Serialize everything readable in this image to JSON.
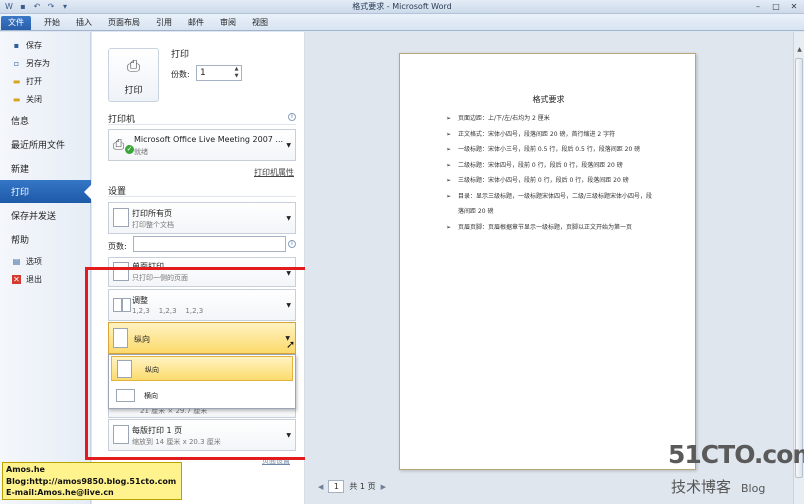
{
  "window": {
    "title": "格式要求 - Microsoft Word",
    "qat_icons": [
      "word-logo-icon",
      "save-icon",
      "undo-icon",
      "redo-icon",
      "customize-icon"
    ],
    "controls": [
      "minimize-icon",
      "maximize-icon",
      "close-icon"
    ]
  },
  "ribbon": {
    "tabs": [
      "文件",
      "开始",
      "插入",
      "页面布局",
      "引用",
      "邮件",
      "审阅",
      "视图"
    ]
  },
  "nav": {
    "save": "保存",
    "save_as": "另存为",
    "open": "打开",
    "close": "关闭",
    "info": "信息",
    "recent": "最近所用文件",
    "new": "新建",
    "print": "打印",
    "save_send": "保存并发送",
    "help": "帮助",
    "options": "选项",
    "exit": "退出"
  },
  "print": {
    "button_label": "打印",
    "heading": "打印",
    "copies_label": "份数:",
    "copies_value": "1",
    "printer_heading": "打印机",
    "printer_name": "Microsoft Office Live Meeting 2007 ...",
    "printer_status": "就绪",
    "printer_properties": "打印机属性",
    "settings_heading": "设置",
    "print_all": "打印所有页",
    "print_all_sub": "打印整个文档",
    "pages_label": "页数:",
    "one_sided": "单面打印",
    "one_sided_sub": "只打印一侧的页面",
    "collate": "调整",
    "collate_sub": "1,2,3    1,2,3    1,2,3",
    "orientation": "纵向",
    "orientation_options": [
      "纵向",
      "横向"
    ],
    "margins_partial": "21 厘米 × 29.7 厘米",
    "per_sheet": "每版打印 1 页",
    "per_sheet_sub": "缩放到 14 厘米 x 20.3 厘米",
    "page_setup": "页面设置"
  },
  "document": {
    "title": "格式要求",
    "items": [
      "页面边距：上/下/左/右均为 2 厘米",
      "正文格式：宋体小四号，段落间距 20 磅，首行缩进 2 字符",
      "一级标题：宋体小三号，段前 0.5 行，段后 0.5 行，段落间距 20 磅",
      "二级标题：宋体四号，段前 0 行，段后 0 行，段落间距 20 磅",
      "三级标题：宋体小四号，段前 0 行，段后 0 行，段落间距 20 磅",
      "目录：显示三级标题，一级标题宋体四号，二级/三级标题宋体小四号，段落间距 20 磅",
      "页眉页脚：页眉根据章节显示一级标题，页脚以正文开始为第一页"
    ]
  },
  "pager": {
    "current": "1",
    "total": "共 1 页"
  },
  "signature": {
    "line1": "Amos.he",
    "line2": "Blog:http://amos9850.blog.51cto.com",
    "line3": "E-mail:Amos.he@live.cn"
  },
  "watermark": {
    "brand": "51CTO.com",
    "sub": "技术博客",
    "blog": "Blog"
  }
}
